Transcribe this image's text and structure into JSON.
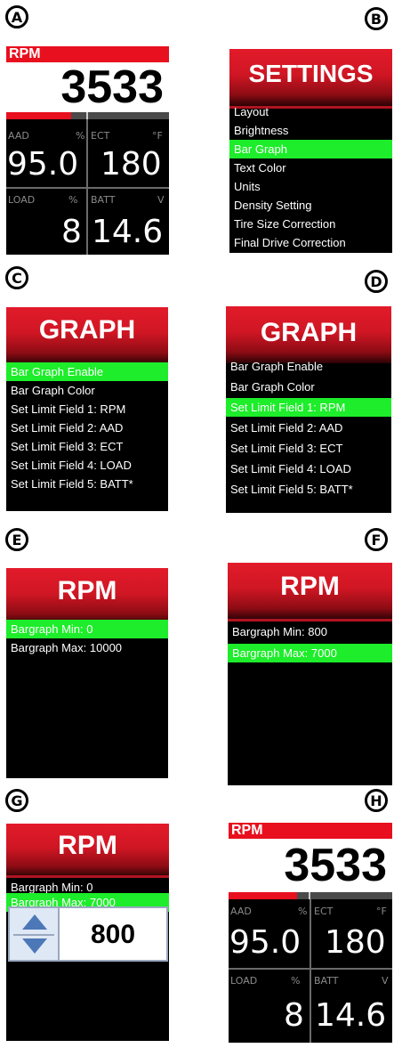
{
  "badges": {
    "a": "A",
    "b": "B",
    "c": "C",
    "d": "D",
    "e": "E",
    "f": "F",
    "g": "G",
    "h": "H"
  },
  "dash_a": {
    "rpm_label": "RPM",
    "rpm_value": "3533",
    "aad_label": "AAD",
    "aad_unit": "%",
    "aad_value": "95.0",
    "ect_label": "ECT",
    "ect_unit": "°F",
    "ect_value": "180",
    "load_label": "LOAD",
    "load_unit": "%",
    "load_value": "8",
    "batt_label": "BATT",
    "batt_unit": "V",
    "batt_value": "14.6",
    "bar_fraction": 0.4
  },
  "settings": {
    "title": "SETTINGS",
    "items": [
      "Layout",
      "Brightness",
      "Bar Graph",
      "Text Color",
      "Units",
      "Density Setting",
      "Tire Size Correction",
      "Final Drive Correction"
    ],
    "selected_index": 2
  },
  "graph_c": {
    "title": "GRAPH",
    "items": [
      "Bar Graph Enable",
      "Bar Graph Color",
      "Set Limit Field 1: RPM",
      "Set Limit Field 2: AAD",
      "Set Limit Field 3: ECT",
      "Set Limit Field 4: LOAD",
      "Set Limit Field 5: BATT*"
    ],
    "selected_index": 0
  },
  "graph_d": {
    "title": "GRAPH",
    "items": [
      "Bar Graph Enable",
      "Bar Graph Color",
      "Set Limit Field 1: RPM",
      "Set Limit Field 2: AAD",
      "Set Limit Field 3: ECT",
      "Set Limit Field 4: LOAD",
      "Set Limit Field 5: BATT*"
    ],
    "selected_index": 2
  },
  "rpm_e": {
    "title": "RPM",
    "items": [
      "Bargraph Min: 0",
      "Bargraph Max: 10000"
    ],
    "selected_index": 0
  },
  "rpm_f": {
    "title": "RPM",
    "items": [
      "Bargraph Min: 800",
      "Bargraph Max: 7000"
    ],
    "selected_index": 1
  },
  "rpm_g": {
    "title": "RPM",
    "items": [
      "Bargraph Min: 0",
      "Bargraph Max: 7000"
    ],
    "selected_index": 1,
    "spinner_value": "800"
  },
  "dash_h": {
    "rpm_label": "RPM",
    "rpm_value": "3533",
    "aad_label": "AAD",
    "aad_unit": "%",
    "aad_value": "95.0",
    "ect_label": "ECT",
    "ect_unit": "°F",
    "ect_value": "180",
    "load_label": "LOAD",
    "load_unit": "%",
    "load_value": "8",
    "batt_label": "BATT",
    "batt_unit": "V",
    "batt_value": "14.6",
    "bar_fraction": 0.42
  },
  "colors": {
    "accent_red": "#e8101e",
    "select_green": "#1ded2a",
    "screen_bg": "#000000"
  }
}
